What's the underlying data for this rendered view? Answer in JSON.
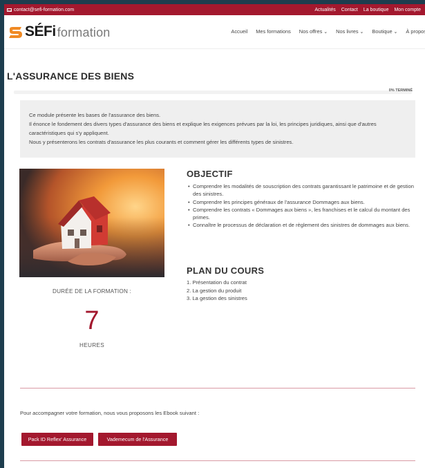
{
  "topbar": {
    "email": "contact@sefi-formation.com",
    "links": [
      "Actualités",
      "Contact",
      "La boutique",
      "Mon compte"
    ]
  },
  "brand": {
    "logo_main": "SÉFi",
    "logo_sub": "formation"
  },
  "nav": {
    "items": [
      "Accueil",
      "Mes formations",
      "Nos offres",
      "Nos livres",
      "Boutique",
      "À propos"
    ]
  },
  "course": {
    "title": "L'ASSURANCE DES BIENS",
    "progress_label": "0% TERMINÉ",
    "progress_fraction": 0,
    "intro": [
      "Ce module présente les bases de l'assurance des biens.",
      "Il énonce le fondement des divers types d'assurance des biens et explique les exigences prévues par la loi, les principes juridiques, ainsi que d'autres caractéristiques qui s'y appliquent.",
      "Nous y présenterons les contrats d'assurance les plus courants et comment gérer les différents types de sinistres."
    ],
    "duration_label": "DURÉE DE LA FORMATION :",
    "duration_value": "7",
    "duration_unit": "HEURES",
    "objectif_title": "OBJECTIF",
    "objectif_items": [
      "Comprendre les modalités de souscription des contrats garantissant le patrimoine et de gestion des sinistres.",
      "Comprendre les principes généraux de l'assurance Dommages aux biens.",
      "Comprendre les contrats « Dommages aux biens », les franchises et le calcul du montant des primes.",
      "Connaître le processus de déclaration et de règlement des sinistres de dommages aux biens."
    ],
    "plan_title": "PLAN DU COURS",
    "plan_items": [
      "1. Présentation du contrat",
      "2. La gestion du produit",
      "3. La gestion des sinistres"
    ]
  },
  "ebook": {
    "text": "Pour accompagner votre formation, nous vous proposons les Ebook suivant :",
    "buttons": [
      "Pack ID Reflex' Assurance",
      "Vademecum de l'Assurance"
    ]
  },
  "colors": {
    "brand": "#a3182e",
    "logo_orange": "#f08a24",
    "frame": "#1d3d4e"
  }
}
